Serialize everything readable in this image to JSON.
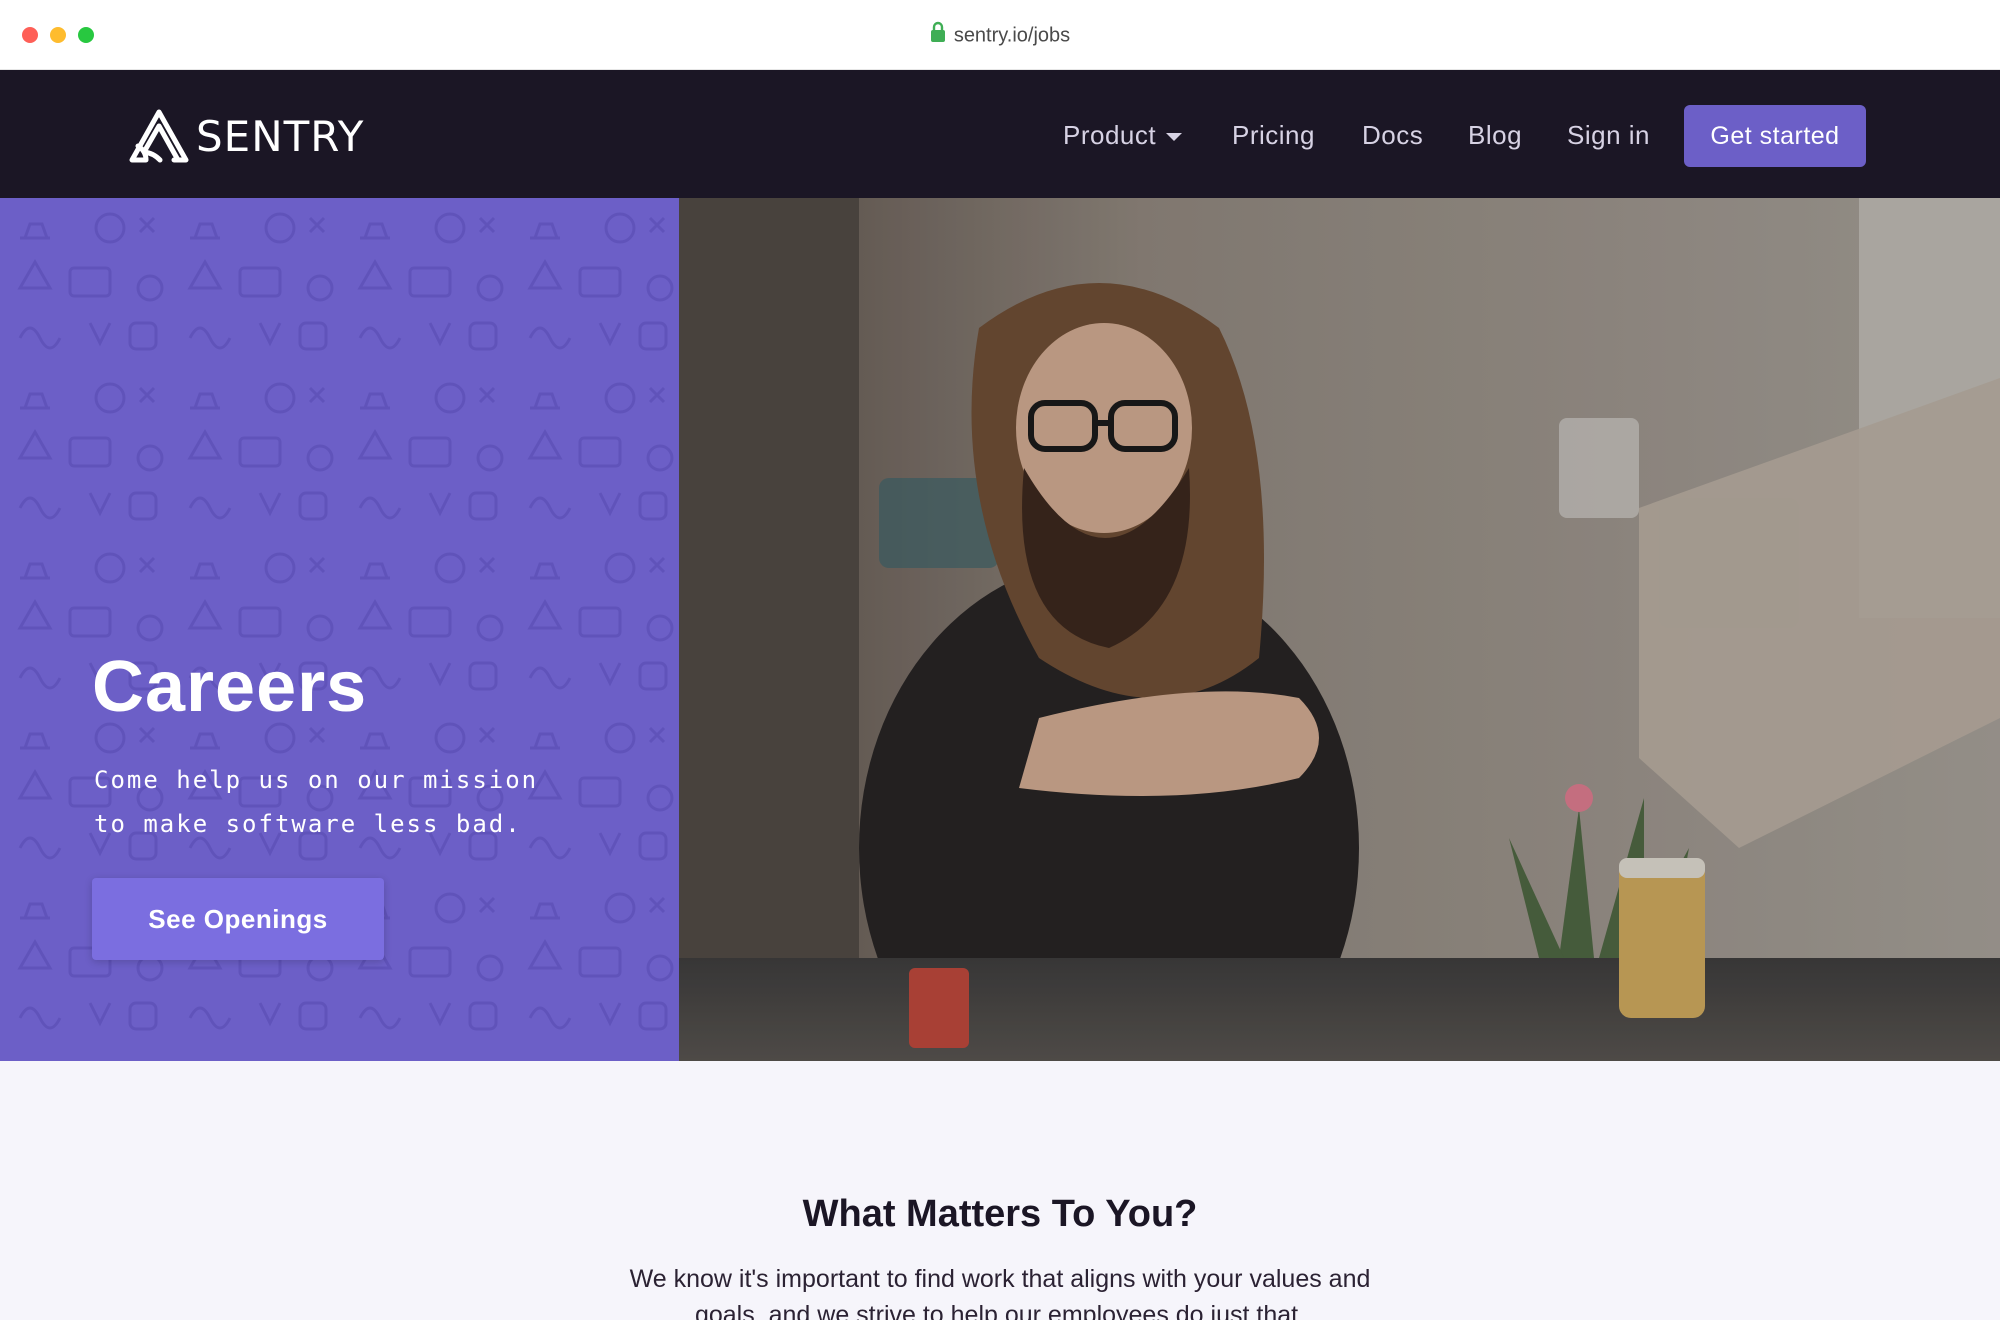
{
  "browser": {
    "url": "sentry.io/jobs"
  },
  "nav": {
    "logo_text": "SENTRY",
    "links": {
      "product": "Product",
      "pricing": "Pricing",
      "docs": "Docs",
      "blog": "Blog",
      "sign_in": "Sign in"
    },
    "cta": "Get started"
  },
  "hero": {
    "title": "Careers",
    "tagline_line1": "Come help us on our mission",
    "tagline_line2": "to make software less bad.",
    "button": "See Openings"
  },
  "section": {
    "title": "What Matters To You?",
    "body": "We know it's important to find work that aligns with your values and goals, and we strive to help our employees do just that."
  },
  "colors": {
    "brand_purple": "#6c5fc7",
    "nav_bg": "#1b1625",
    "button_purple": "#7b6ee0"
  }
}
